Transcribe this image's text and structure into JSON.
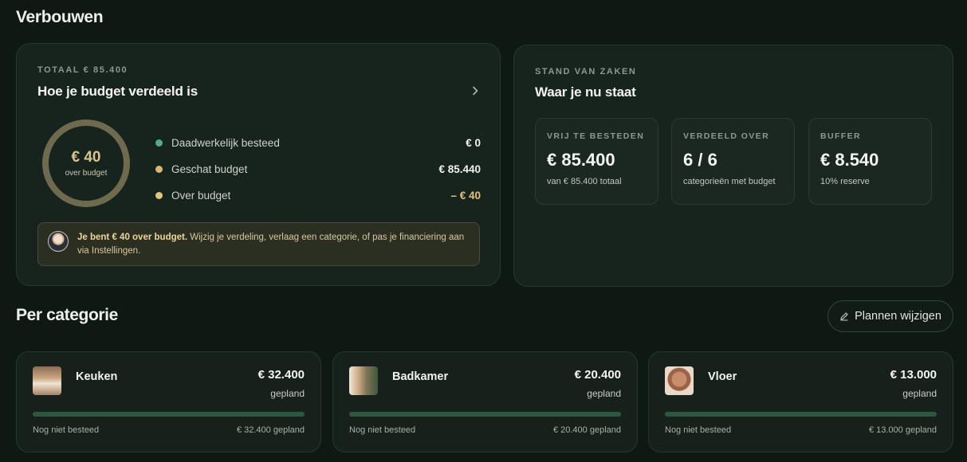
{
  "page": {
    "title": "Verbouwen"
  },
  "budget": {
    "eyebrow": "TOTAAL € 85.400",
    "title": "Hoe je budget verdeeld is",
    "ring": {
      "value": "€ 40",
      "label": "over budget"
    },
    "legend": [
      {
        "label": "Daadwerkelijk besteed",
        "value": "€ 0",
        "color": "#4fae7f"
      },
      {
        "label": "Geschat budget",
        "value": "€ 85.440",
        "color": "#d9b870"
      },
      {
        "label": "Over budget",
        "value": "– € 40",
        "color": "#e3c47e"
      }
    ],
    "alert": {
      "strong": "Je bent € 40 over budget.",
      "text": " Wijzig je verdeling, verlaag een categorie, of pas je financiering aan via Instellingen."
    }
  },
  "status": {
    "eyebrow": "STAND VAN ZAKEN",
    "title": "Waar je nu staat",
    "stats": [
      {
        "label": "VRIJ TE BESTEDEN",
        "value": "€ 85.400",
        "sub": "van € 85.400 totaal"
      },
      {
        "label": "VERDEELD OVER",
        "value": "6 / 6",
        "sub": "categorieën met budget"
      },
      {
        "label": "BUFFER",
        "value": "€ 8.540",
        "sub": "10% reserve"
      }
    ]
  },
  "categories": {
    "title": "Per categorie",
    "action_label": "Plannen wijzigen",
    "items": [
      {
        "name": "Keuken",
        "amount": "€ 32.400",
        "sub": "gepland",
        "status": "Nog niet besteed",
        "planned": "€ 32.400 gepland",
        "progress": 1.0
      },
      {
        "name": "Badkamer",
        "amount": "€ 20.400",
        "sub": "gepland",
        "status": "Nog niet besteed",
        "planned": "€ 20.400 gepland",
        "progress": 1.0
      },
      {
        "name": "Vloer",
        "amount": "€ 13.000",
        "sub": "gepland",
        "status": "Nog niet besteed",
        "planned": "€ 13.000 gepland",
        "progress": 1.0
      }
    ]
  }
}
